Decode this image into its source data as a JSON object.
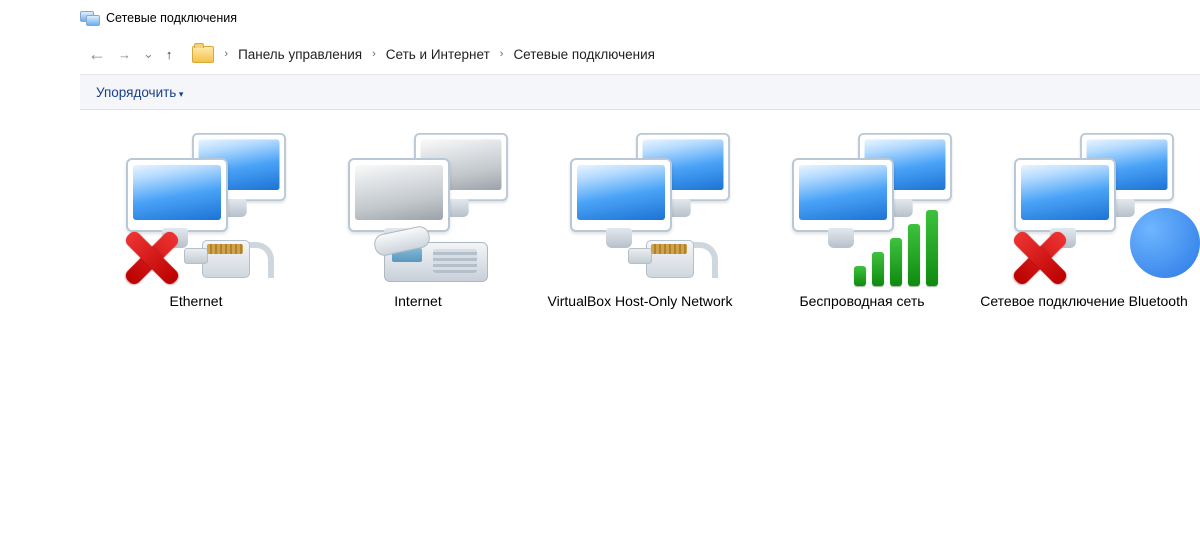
{
  "window": {
    "title": "Сетевые подключения"
  },
  "nav": {
    "back_icon": "←",
    "forward_icon": "→",
    "dropdown_icon": "⌄",
    "up_icon": "↑"
  },
  "breadcrumbs": {
    "sep": "›",
    "items": [
      "Панель управления",
      "Сеть и Интернет",
      "Сетевые подключения"
    ]
  },
  "toolbar": {
    "organize": "Упорядочить"
  },
  "connections": [
    {
      "name": "Ethernet",
      "style": "blue",
      "decor": "plug",
      "status": "disconnected"
    },
    {
      "name": "Internet",
      "style": "grey",
      "decor": "phone",
      "status": "ok"
    },
    {
      "name": "VirtualBox Host-Only Network",
      "style": "blue",
      "decor": "plug",
      "status": "ok"
    },
    {
      "name": "Беспроводная сеть",
      "style": "blue",
      "decor": "wifi",
      "status": "ok"
    },
    {
      "name": "Сетевое подключение Bluetooth",
      "style": "blue",
      "decor": "bluetooth",
      "status": "disconnected"
    }
  ]
}
